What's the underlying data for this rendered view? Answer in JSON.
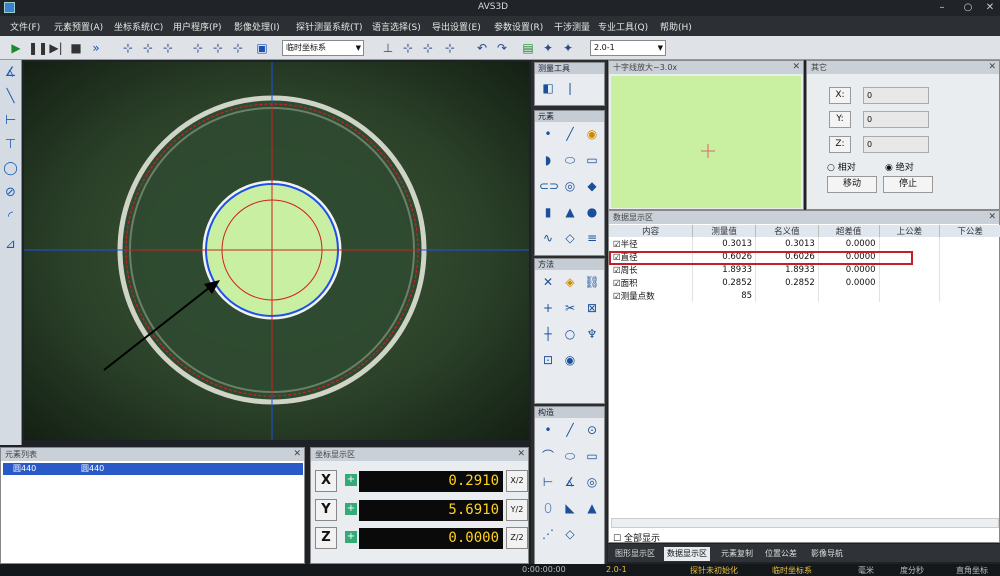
{
  "app": {
    "title": "AVS3D"
  },
  "menu": [
    "文件(F)",
    "元素预置(A)",
    "坐标系统(C)",
    "用户程序(P)",
    "影像处理(I)",
    "探针测量系统(T)",
    "语言选择(S)",
    "导出设置(E)",
    "参数设置(R)",
    "干涉测量",
    "专业工具(Q)",
    "帮助(H)"
  ],
  "toolbar": {
    "coord_select": "临时坐标系",
    "zoom_select": "2.0-1"
  },
  "panels": {
    "measure_tools": "测量工具",
    "elements": "元素",
    "methods": "方法",
    "construct": "构造",
    "minimap": "十字线放大~3.0x",
    "other": "其它",
    "data_display": "数据显示区",
    "element_list": "元素列表",
    "coord_display": "坐标显示区"
  },
  "other": {
    "x_label": "X:",
    "x_value": "0",
    "y_label": "Y:",
    "y_value": "0",
    "z_label": "Z:",
    "z_value": "0",
    "relative": "相对",
    "absolute": "绝对",
    "move": "移动",
    "stop": "停止"
  },
  "data_table": {
    "headers": [
      "内容",
      "测量值",
      "名义值",
      "超差值",
      "上公差",
      "下公差"
    ],
    "rows": [
      {
        "name": "半径",
        "measured": "0.3013",
        "nominal": "0.3013",
        "deviation": "0.0000"
      },
      {
        "name": "直径",
        "measured": "0.6026",
        "nominal": "0.6026",
        "deviation": "0.0000"
      },
      {
        "name": "周长",
        "measured": "1.8933",
        "nominal": "1.8933",
        "deviation": "0.0000"
      },
      {
        "name": "面积",
        "measured": "0.2852",
        "nominal": "0.2852",
        "deviation": "0.0000"
      },
      {
        "name": "测量点数",
        "measured": "85",
        "nominal": "",
        "deviation": ""
      }
    ],
    "show_all": "全部显示"
  },
  "bottom_tabs": [
    "图形显示区",
    "数据显示区",
    "元素复制",
    "位置公差",
    "影像导航"
  ],
  "element_list": {
    "item_a": "圆440",
    "item_b": "圆440"
  },
  "coords": {
    "x_axis": "X",
    "x_value": "0.2910",
    "x_btn": "X/2",
    "y_axis": "Y",
    "y_value": "5.6910",
    "y_btn": "Y/2",
    "z_axis": "Z",
    "z_value": "0.0000",
    "z_btn": "Z/2",
    "sign": "+"
  },
  "status": {
    "time": "0:00:00:00",
    "zoom": "2.0-1",
    "probe": "探针未初始化",
    "coord": "临时坐标系",
    "unit": "毫米",
    "angle": "度分秒",
    "cartesian": "直角坐标"
  },
  "colors": {
    "accent_red": "#c0202a",
    "coord_yellow": "#ffd21e",
    "crosshair_blue": "#1e50e6",
    "contour_red": "#d02020"
  }
}
